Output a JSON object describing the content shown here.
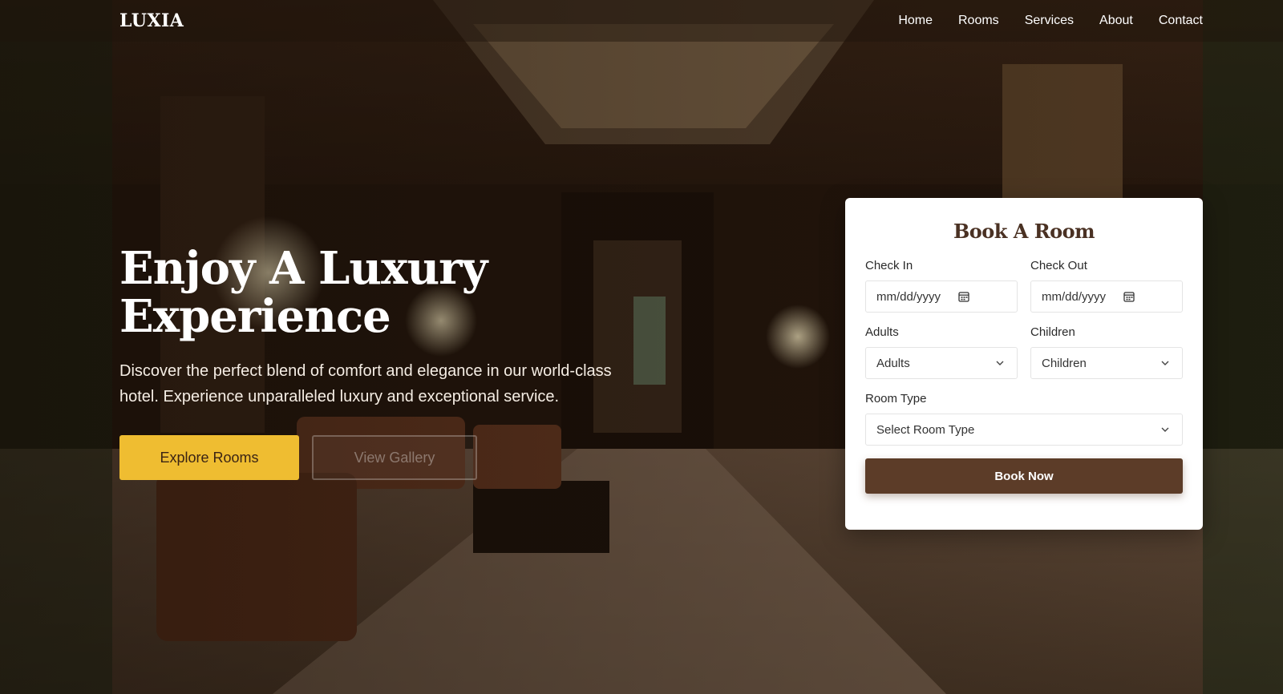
{
  "brand": {
    "logo": "LUXIA"
  },
  "nav": {
    "items": [
      {
        "label": "Home"
      },
      {
        "label": "Rooms"
      },
      {
        "label": "Services"
      },
      {
        "label": "About"
      },
      {
        "label": "Contact"
      }
    ]
  },
  "hero": {
    "title_line1": "Enjoy A Luxury",
    "title_line2": "Experience",
    "description": "Discover the perfect blend of comfort and elegance in our world-class hotel. Experience unparalleled luxury and exceptional service.",
    "primary_button": "Explore Rooms",
    "secondary_button": "View Gallery"
  },
  "booking": {
    "title": "Book A Room",
    "check_in": {
      "label": "Check In",
      "value": "mm/dd/yyyy"
    },
    "check_out": {
      "label": "Check Out",
      "value": "mm/dd/yyyy"
    },
    "adults": {
      "label": "Adults",
      "value": "Adults"
    },
    "children": {
      "label": "Children",
      "value": "Children"
    },
    "room_type": {
      "label": "Room Type",
      "value": "Select Room Type"
    },
    "submit": "Book Now"
  },
  "colors": {
    "accent": "#efbd31",
    "primary_button": "#5c3c28",
    "title_text": "#4a3123"
  },
  "icons": [
    "calendar-icon",
    "chevron-down-icon"
  ]
}
